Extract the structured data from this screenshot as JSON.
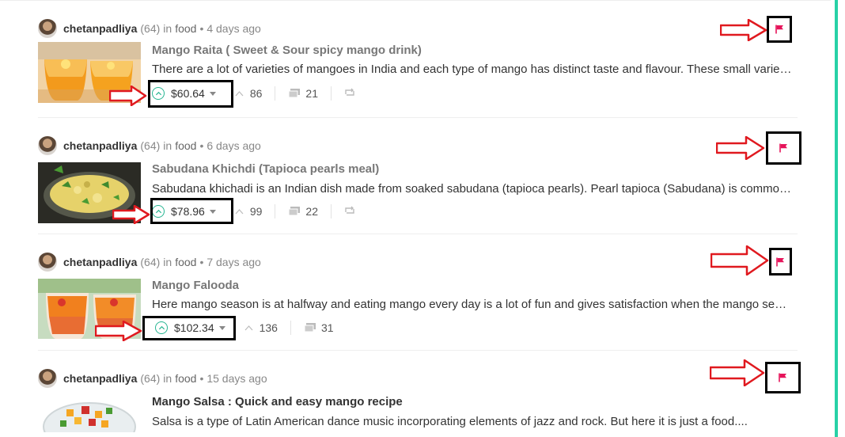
{
  "posts": [
    {
      "author": "chetanpadliya",
      "reputation": "(64)",
      "in_label": "in",
      "category": "food",
      "separator": "•",
      "time": "4 days ago",
      "title": "Mango Raita ( Sweet & Sour spicy mango drink)",
      "excerpt": "There are a lot of varieties of mangoes in India and each type of mango has distinct taste and flavour. These small variety mangoes are great",
      "payout": "$60.64",
      "votes": "86",
      "comments": "21"
    },
    {
      "author": "chetanpadliya",
      "reputation": "(64)",
      "in_label": "in",
      "category": "food",
      "separator": "•",
      "time": "6 days ago",
      "title": "Sabudana Khichdi (Tapioca pearls meal)",
      "excerpt": "Sabudana khichadi is an Indian dish made from soaked sabudana (tapioca pearls). Pearl tapioca (Sabudana) is common ingredient",
      "payout": "$78.96",
      "votes": "99",
      "comments": "22"
    },
    {
      "author": "chetanpadliya",
      "reputation": "(64)",
      "in_label": "in",
      "category": "food",
      "separator": "•",
      "time": "7 days ago",
      "title": "Mango Falooda",
      "excerpt": "Here mango season is at halfway and eating mango every day is a lot of fun and gives satisfaction when the mango season ends",
      "payout": "$102.34",
      "votes": "136",
      "comments": "31"
    },
    {
      "author": "chetanpadliya",
      "reputation": "(64)",
      "in_label": "in",
      "category": "food",
      "separator": "•",
      "time": "15 days ago",
      "title": "Mango Salsa : Quick and easy mango recipe",
      "excerpt": "Salsa is a type of Latin American dance music incorporating elements of jazz and rock. But here it is just a food...."
    }
  ],
  "colors": {
    "accent": "#27d1a6",
    "upvote": "#27b592",
    "flag": "#e6145a",
    "annotation_arrow": "#e0191f",
    "annotation_box": "#000000"
  },
  "icons": [
    "upvote-icon",
    "caret-down-icon",
    "votes-chevron-icon",
    "comments-icon",
    "reblog-icon",
    "flag-icon",
    "avatar"
  ]
}
